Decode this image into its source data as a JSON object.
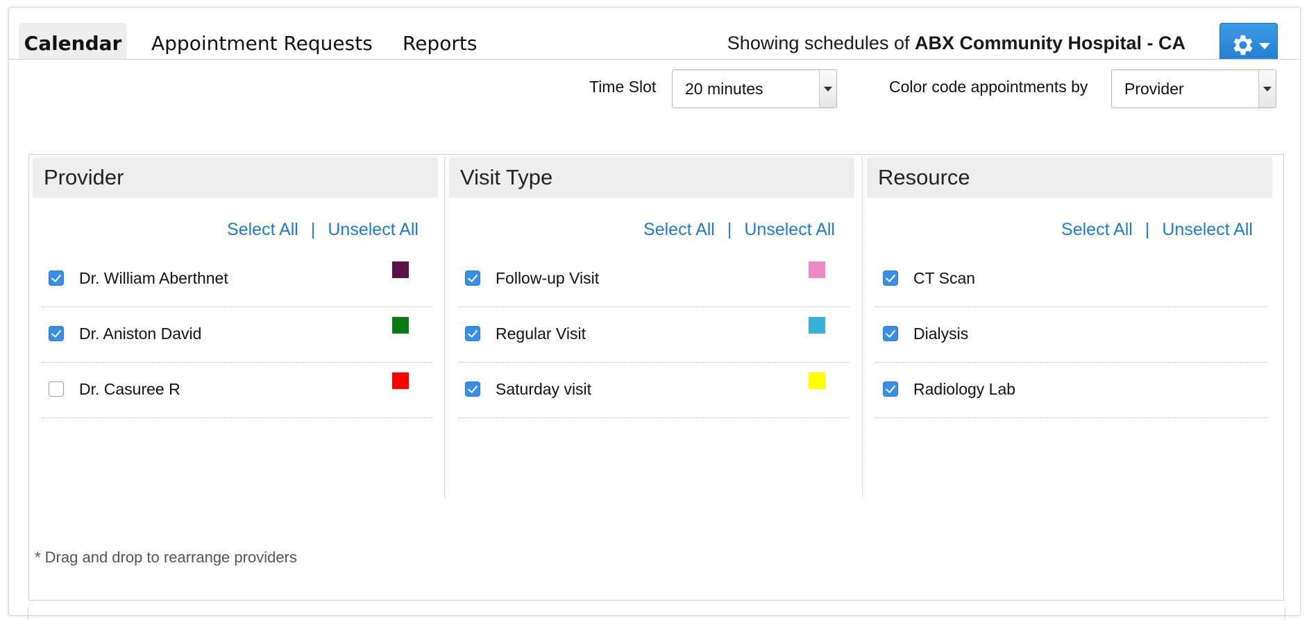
{
  "tabs": [
    {
      "label": "Calendar",
      "active": true
    },
    {
      "label": "Appointment Requests",
      "active": false
    },
    {
      "label": "Reports",
      "active": false
    }
  ],
  "header": {
    "showing_prefix": "Showing schedules of",
    "hospital": "ABX Community Hospital - CA",
    "settings_icon": "gear-icon"
  },
  "controls": {
    "time_slot_label": "Time Slot",
    "time_slot_value": "20 minutes",
    "color_code_label": "Color code appointments by",
    "color_code_value": "Provider"
  },
  "columns": [
    {
      "title": "Provider",
      "select_all": "Select All",
      "unselect_all": "Unselect All",
      "items": [
        {
          "label": "Dr. William Aberthnet",
          "checked": true,
          "color": "#5c1248"
        },
        {
          "label": "Dr. Aniston David",
          "checked": true,
          "color": "#0a7a12"
        },
        {
          "label": "Dr. Casuree R",
          "checked": false,
          "color": "#ff0000"
        }
      ]
    },
    {
      "title": "Visit Type",
      "select_all": "Select All",
      "unselect_all": "Unselect All",
      "items": [
        {
          "label": "Follow-up Visit",
          "checked": true,
          "color": "#ee88c8"
        },
        {
          "label": "Regular Visit",
          "checked": true,
          "color": "#3aaedc"
        },
        {
          "label": "Saturday visit",
          "checked": true,
          "color": "#ffff00"
        }
      ]
    },
    {
      "title": "Resource",
      "select_all": "Select All",
      "unselect_all": "Unselect All",
      "items": [
        {
          "label": "CT Scan",
          "checked": true
        },
        {
          "label": "Dialysis",
          "checked": true
        },
        {
          "label": "Radiology Lab",
          "checked": true
        }
      ]
    }
  ],
  "note": "* Drag and drop to rearrange providers",
  "colors": {
    "accent": "#1f7ad0",
    "checkbox": "#3a8ee6"
  }
}
